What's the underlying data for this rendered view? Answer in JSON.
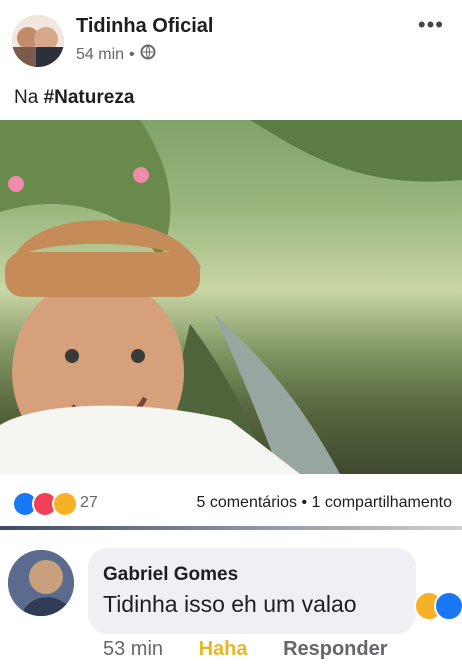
{
  "post": {
    "author": "Tidinha Oficial",
    "time": "54 min",
    "privacy_icon": "globe-icon",
    "text_prefix": "Na ",
    "hashtag": "#Natureza",
    "photo_description": "selfie by a tree-lined canal"
  },
  "reactions": {
    "icons": [
      "like-icon",
      "love-icon",
      "sad-icon"
    ],
    "count": "27",
    "comments": "5 comentários",
    "shares": "1 compartilhamento"
  },
  "comment": {
    "author": "Gabriel Gomes",
    "text": "Tidinha isso eh um valao",
    "reaction_icons": [
      "haha-icon",
      "like-icon"
    ],
    "time": "53 min",
    "user_reaction": "Haha",
    "reply": "Responder"
  },
  "colors": {
    "like": "#1877f2",
    "love": "#f33e58",
    "sad": "#f7b125",
    "haha": "#e7b824"
  }
}
